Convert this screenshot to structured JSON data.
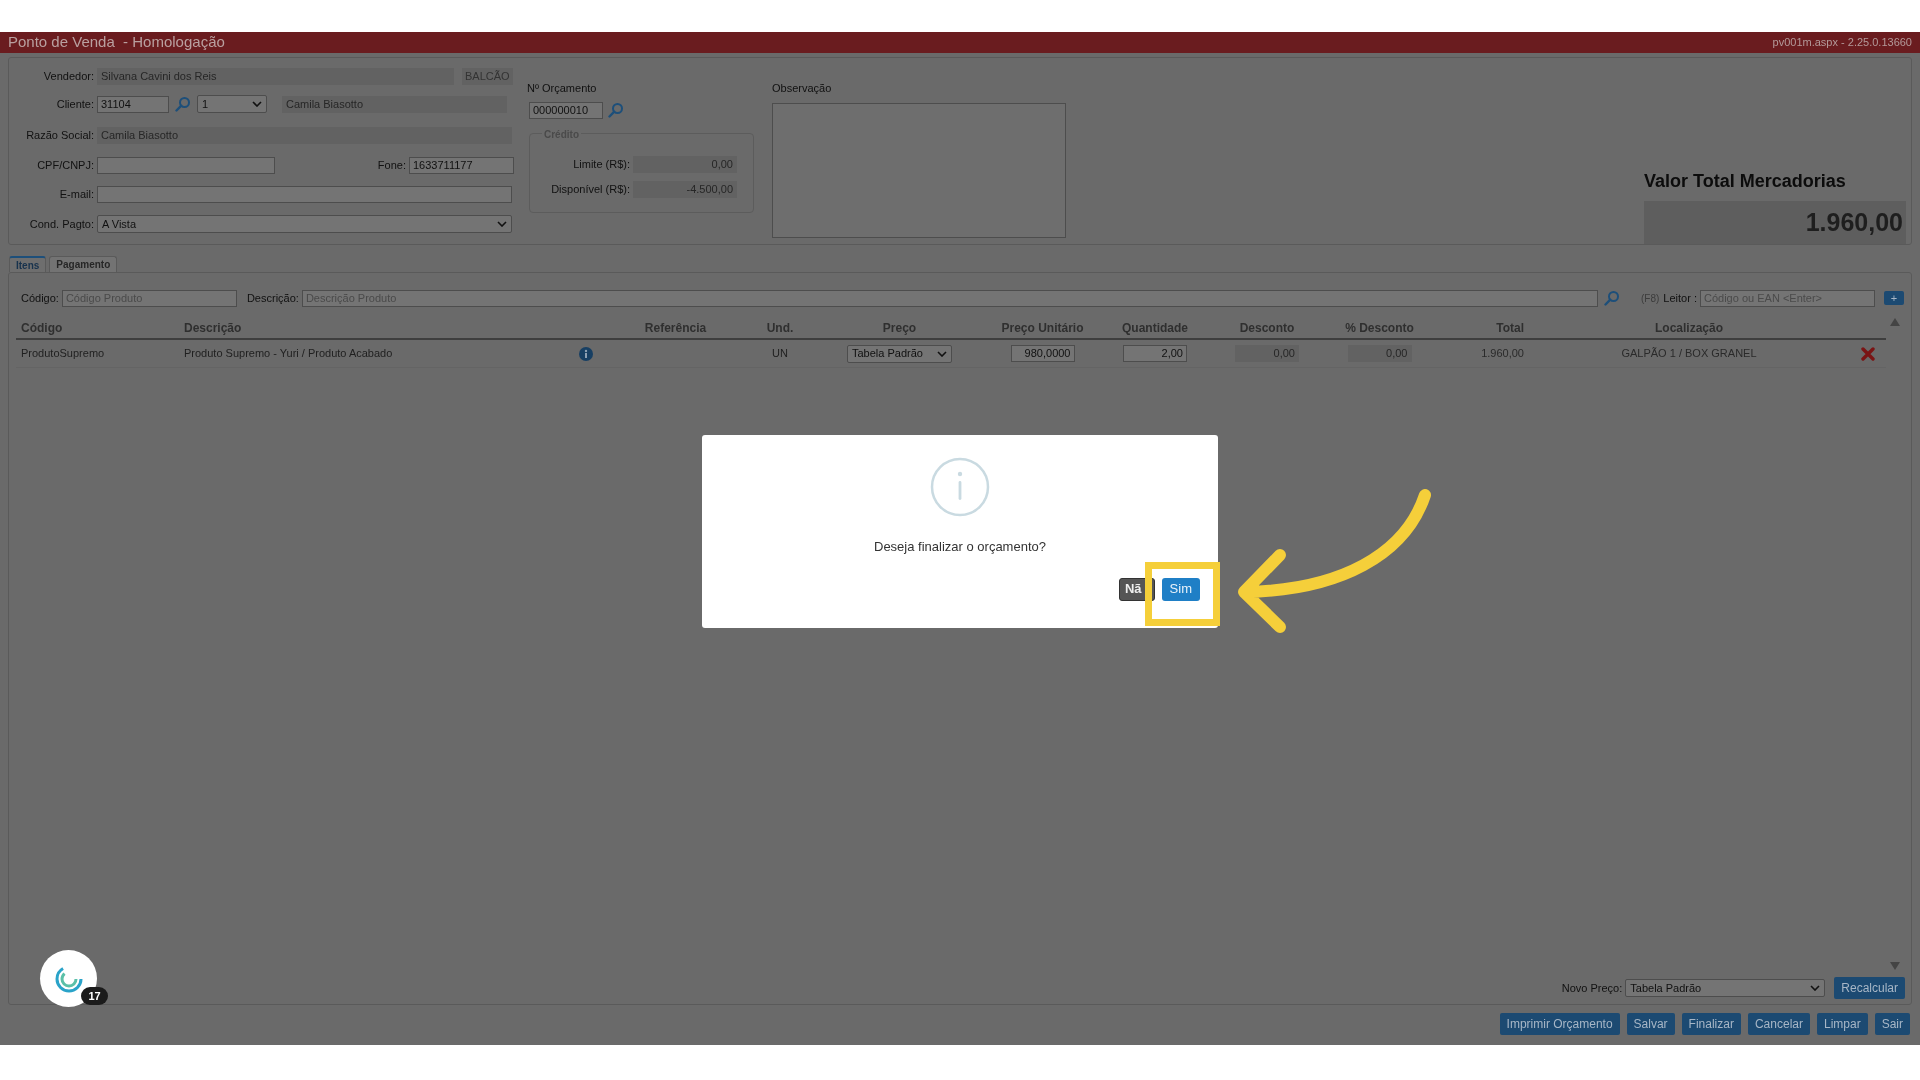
{
  "window": {
    "title": "Ponto de Venda  - Homologação",
    "version": "pv001m.aspx - 2.25.0.13660"
  },
  "form": {
    "seller": {
      "label": "Vendedor:",
      "value": "Silvana Cavini dos Reis",
      "tag": "BALCÃO"
    },
    "client": {
      "label": "Cliente:",
      "code": "31104",
      "option": "1",
      "name": "Camila Biasotto"
    },
    "company": {
      "label": "Razão Social:",
      "value": "Camila Biasotto"
    },
    "tax_id": {
      "label": "CPF/CNPJ:"
    },
    "phone": {
      "label": "Fone:",
      "value": "1633711177"
    },
    "email": {
      "label": "E-mail:"
    },
    "payment": {
      "label": "Cond. Pagto:",
      "value": "A Vista"
    }
  },
  "quote": {
    "label": "Nº Orçamento",
    "value": "000000010"
  },
  "credit": {
    "title": "Crédito",
    "rows": [
      {
        "label": "Limite (R$):",
        "value": "0,00"
      },
      {
        "label": "Disponível (R$):",
        "value": "-4.500,00"
      }
    ]
  },
  "notes": {
    "label": "Observação"
  },
  "total": {
    "label": "Valor Total Mercadorias",
    "value": "1.960,00"
  },
  "tabs": [
    {
      "label": "Itens",
      "selected": true
    },
    {
      "label": "Pagamento",
      "selected": false
    }
  ],
  "search": {
    "code": {
      "label": "Código:",
      "placeholder": "Código Produto"
    },
    "description": {
      "label": "Descrição:",
      "placeholder": "Descrição Produto"
    },
    "shortcut": "(F8)",
    "reader": {
      "label": "Leitor :",
      "placeholder": "Código ou EAN <Enter>"
    },
    "add": "+"
  },
  "table": {
    "columns": [
      "Código",
      "Descrição",
      "Referência",
      "Und.",
      "Preço",
      "Preço Unitário",
      "Quantidade",
      "Desconto",
      "% Desconto",
      "Total",
      "Localização"
    ],
    "rows": [
      {
        "code": "ProdutoSupremo",
        "description": "Produto Supremo - Yuri / Produto Acabado",
        "unit": "UN",
        "price_table": "Tabela Padrão",
        "unit_price": "980,0000",
        "quantity": "2,00",
        "discount": "0,00",
        "discount_pct": "0,00",
        "total": "1.960,00",
        "location": "GALPÃO 1 / BOX GRANEL"
      }
    ]
  },
  "reprice": {
    "label": "Novo Preço:",
    "value": "Tabela Padrão",
    "button": "Recalcular"
  },
  "actions": [
    "Imprimir Orçamento",
    "Salvar",
    "Finalizar",
    "Cancelar",
    "Limpar",
    "Sair"
  ],
  "dialog": {
    "message": "Deseja finalizar o orçamento?",
    "buttons": [
      {
        "label": "Nã",
        "kind": "secondary"
      },
      {
        "label": "Sim",
        "kind": "primary"
      }
    ]
  },
  "chat": {
    "badge": "17"
  }
}
